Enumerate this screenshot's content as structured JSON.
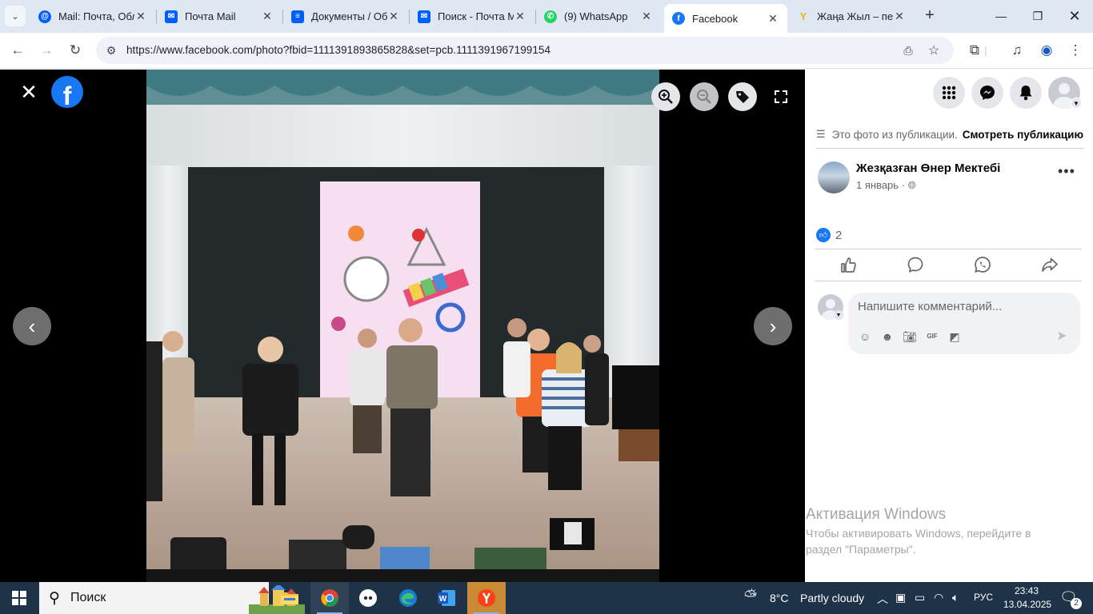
{
  "browser": {
    "tabs": [
      {
        "title": "Mail: Почта, Обл",
        "favicon": "mail-at-icon",
        "color": "#005ff9"
      },
      {
        "title": "Почта Mail",
        "favicon": "mail-envelope-icon",
        "color": "#005ff9"
      },
      {
        "title": "Документы / Об",
        "favicon": "docs-icon",
        "color": "#005ff9"
      },
      {
        "title": "Поиск - Почта М",
        "favicon": "mail-envelope-icon",
        "color": "#005ff9"
      },
      {
        "title": "(9) WhatsApp",
        "favicon": "whatsapp-icon",
        "color": "#25d366"
      },
      {
        "title": "Facebook",
        "favicon": "facebook-icon",
        "color": "#1877f2",
        "active": true
      },
      {
        "title": "Жаңа Жыл – пер",
        "favicon": "yandex-icon",
        "color": "#ffcc00"
      }
    ],
    "url": "https://www.facebook.com/photo?fbid=1111391893865828&set=pcb.1111391967199154"
  },
  "panel": {
    "pub_note": "Это фото из публикации.",
    "see_pub": "Смотреть публикацию",
    "page_name": "Жезқазған Өнер Мектебі",
    "post_date": "1 январь",
    "likes": "2",
    "comment_placeholder": "Напишите комментарий..."
  },
  "watermark": {
    "title": "Активация Windows",
    "body": "Чтобы активировать Windows, перейдите в раздел \"Параметры\"."
  },
  "taskbar": {
    "search": "Поиск",
    "weather_temp": "8°C",
    "weather_desc": "Partly cloudy",
    "lang": "РУС",
    "time": "23:43",
    "date": "13.04.2025",
    "notifications": "2"
  },
  "colors": {
    "facebook_blue": "#1877f2",
    "taskbar": "#1f3348",
    "tabstrip": "#dfe7f3"
  }
}
